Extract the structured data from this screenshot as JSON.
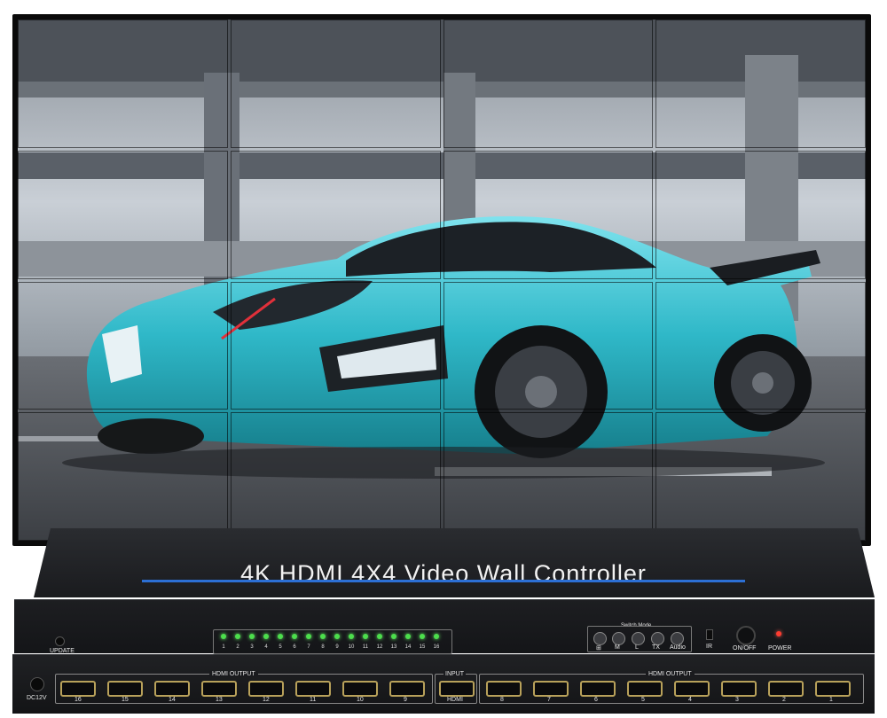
{
  "product": {
    "title": "4K HDMI 4X4 Video Wall Controller",
    "update_label": "UPDATE",
    "dc_label": "DC12V",
    "switch_mode_label": "Switch Mode",
    "mode_buttons": [
      "⊞",
      "M",
      "L",
      "TX",
      "Audio"
    ],
    "ir_label": "IR",
    "onoff_label": "ON/OFF",
    "power_label": "POWER",
    "led_numbers": [
      "1",
      "2",
      "3",
      "4",
      "5",
      "6",
      "7",
      "8",
      "9",
      "10",
      "11",
      "12",
      "13",
      "14",
      "15",
      "16"
    ],
    "hdmi_output_label": "HDMI OUTPUT",
    "input_label": "INPUT",
    "input_port_label": "HDMI",
    "left_ports": [
      "16",
      "15",
      "14",
      "13",
      "12",
      "11",
      "10",
      "9"
    ],
    "right_ports": [
      "8",
      "7",
      "6",
      "5",
      "4",
      "3",
      "2",
      "1"
    ]
  },
  "colors": {
    "accent_line": "#2c6fd4",
    "led_green": "#4cde4c",
    "power_led": "#ff3b30",
    "car": "#2fb8c8"
  }
}
